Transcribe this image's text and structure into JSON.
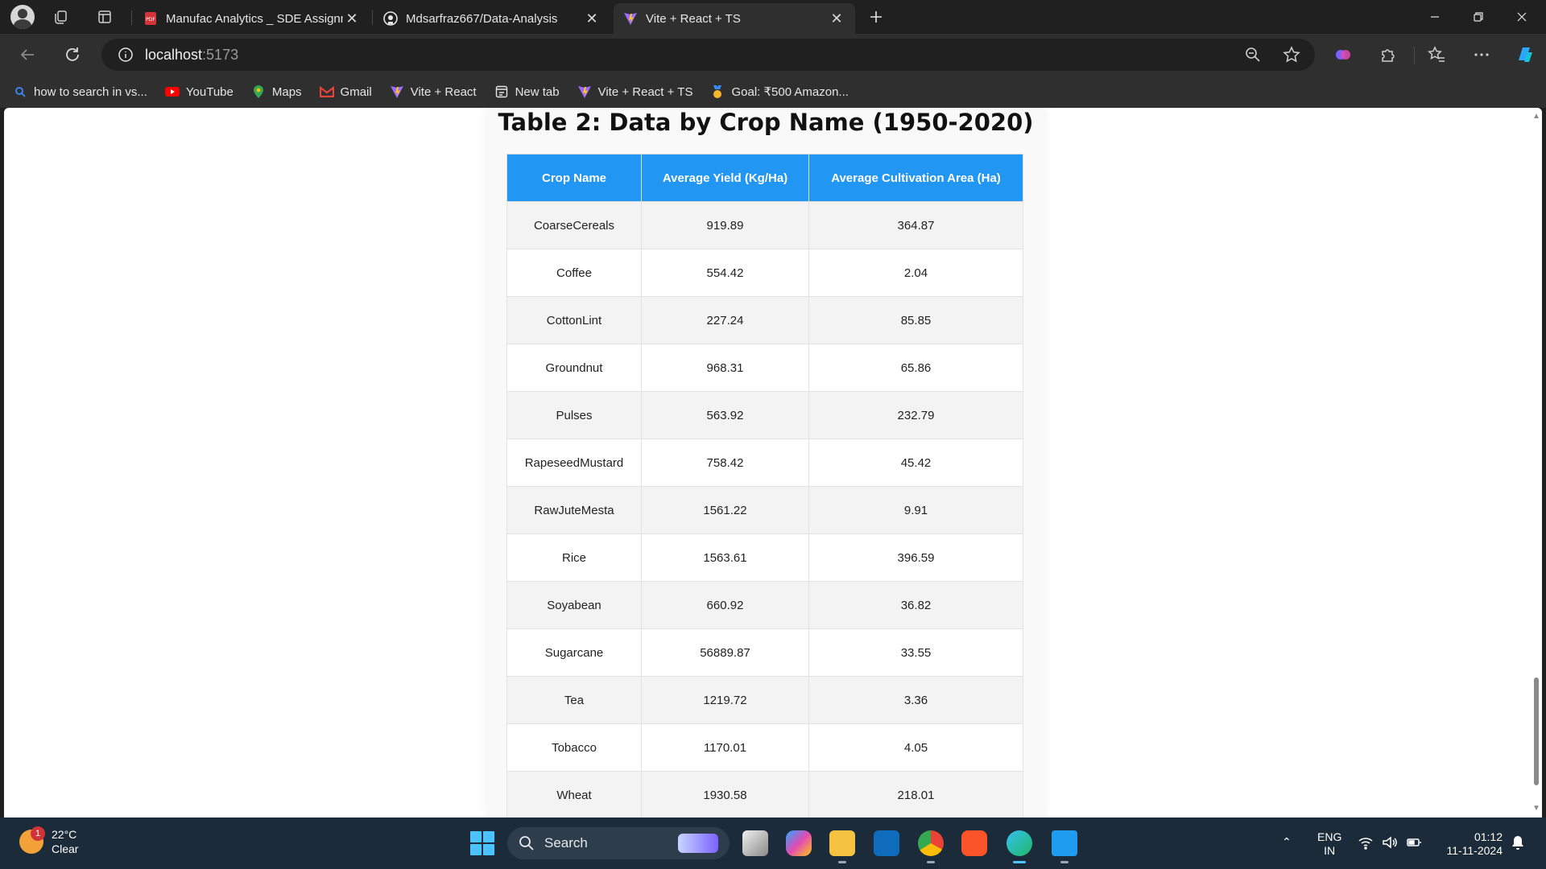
{
  "browser": {
    "tabs": [
      {
        "title": "Manufac Analytics _ SDE Assignm",
        "favicon": "pdf-icon"
      },
      {
        "title": "Mdsarfraz667/Data-Analysis",
        "favicon": "github-icon"
      },
      {
        "title": "Vite + React + TS",
        "favicon": "vite-icon"
      }
    ],
    "address": {
      "host": "localhost",
      "port": ":5173"
    },
    "bookmarks": [
      {
        "label": "how to search in vs...",
        "icon": "search-icon"
      },
      {
        "label": "YouTube",
        "icon": "youtube-icon"
      },
      {
        "label": "Maps",
        "icon": "maps-icon"
      },
      {
        "label": "Gmail",
        "icon": "gmail-icon"
      },
      {
        "label": "Vite + React",
        "icon": "vite-icon"
      },
      {
        "label": "New tab",
        "icon": "new-tab-icon"
      },
      {
        "label": "Vite + React + TS",
        "icon": "vite-icon"
      },
      {
        "label": "Goal: ₹500 Amazon...",
        "icon": "medal-icon"
      }
    ]
  },
  "page": {
    "title": "Table 2: Data by Crop Name (1950-2020)",
    "table": {
      "headers": [
        "Crop Name",
        "Average Yield (Kg/Ha)",
        "Average Cultivation Area (Ha)"
      ],
      "rows": [
        [
          "CoarseCereals",
          "919.89",
          "364.87"
        ],
        [
          "Coffee",
          "554.42",
          "2.04"
        ],
        [
          "CottonLint",
          "227.24",
          "85.85"
        ],
        [
          "Groundnut",
          "968.31",
          "65.86"
        ],
        [
          "Pulses",
          "563.92",
          "232.79"
        ],
        [
          "RapeseedMustard",
          "758.42",
          "45.42"
        ],
        [
          "RawJuteMesta",
          "1561.22",
          "9.91"
        ],
        [
          "Rice",
          "1563.61",
          "396.59"
        ],
        [
          "Soyabean",
          "660.92",
          "36.82"
        ],
        [
          "Sugarcane",
          "56889.87",
          "33.55"
        ],
        [
          "Tea",
          "1219.72",
          "3.36"
        ],
        [
          "Tobacco",
          "1170.01",
          "4.05"
        ],
        [
          "Wheat",
          "1930.58",
          "218.01"
        ]
      ]
    },
    "header_color": "#2196f3"
  },
  "taskbar": {
    "weather": {
      "temp": "22°C",
      "condition": "Clear",
      "badge": "1"
    },
    "search_label": "Search",
    "lang": {
      "line1": "ENG",
      "line2": "IN"
    },
    "clock": {
      "time": "01:12",
      "date": "11-11-2024"
    }
  }
}
